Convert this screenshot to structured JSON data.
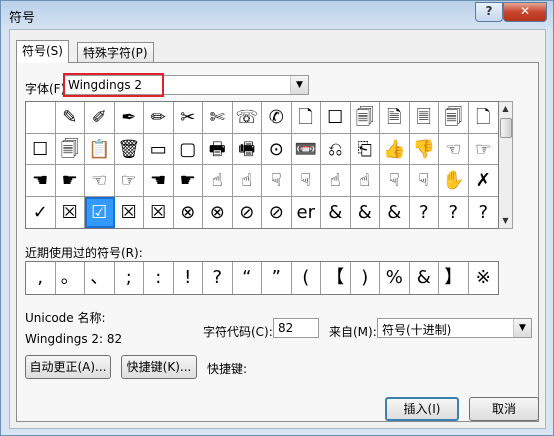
{
  "window": {
    "title": "符号",
    "help_label": "?",
    "close_label": "✕"
  },
  "tabs": [
    {
      "label": "符号(S)"
    },
    {
      "label": "特殊字符(P)"
    }
  ],
  "font": {
    "label": "字体(F):",
    "value": "Wingdings 2"
  },
  "symbols": [
    "",
    "✎",
    "✐",
    "✒",
    "✏",
    "✂",
    "✄",
    "☏",
    "✆",
    "🗋",
    "☐",
    "🗐",
    "🗎",
    "🗏",
    "🗐",
    "🗋",
    "☐",
    "🗐",
    "📋",
    "🗑",
    "▭",
    "▢",
    "🖶",
    "🖷",
    "⊙",
    "📼",
    "⎌",
    "⎗",
    "👍",
    "👎",
    "☜",
    "☞",
    "☚",
    "☛",
    "☜",
    "☞",
    "☚",
    "☛",
    "☝",
    "☝",
    "☟",
    "☟",
    "☝",
    "☝",
    "☟",
    "☟",
    "✋",
    "✗",
    "✓",
    "☒",
    "☑",
    "☒",
    "☒",
    "⊗",
    "⊗",
    "⊘",
    "⊘",
    "er",
    "&",
    "&",
    "&",
    "?",
    "?",
    "?"
  ],
  "recent": {
    "label": "近期使用过的符号(R):",
    "items": [
      ",",
      "。",
      "、",
      ";",
      ":",
      "!",
      "?",
      "“",
      "”",
      "(",
      "【",
      ")",
      "%",
      "&",
      "】",
      "※"
    ]
  },
  "unicode_name": {
    "label": "Unicode 名称:",
    "value": "Wingdings 2: 82"
  },
  "char_code": {
    "label": "字符代码(C):",
    "value": "82"
  },
  "from": {
    "label": "来自(M):",
    "value": "符号(十进制)"
  },
  "buttons": {
    "autocorrect": "自动更正(A)...",
    "shortcut": "快捷键(K)...",
    "shortcut_label": "快捷键:",
    "insert": "插入(I)",
    "cancel": "取消"
  },
  "colors": {
    "accent": "#3399ff",
    "highlight": "#e0202a"
  }
}
